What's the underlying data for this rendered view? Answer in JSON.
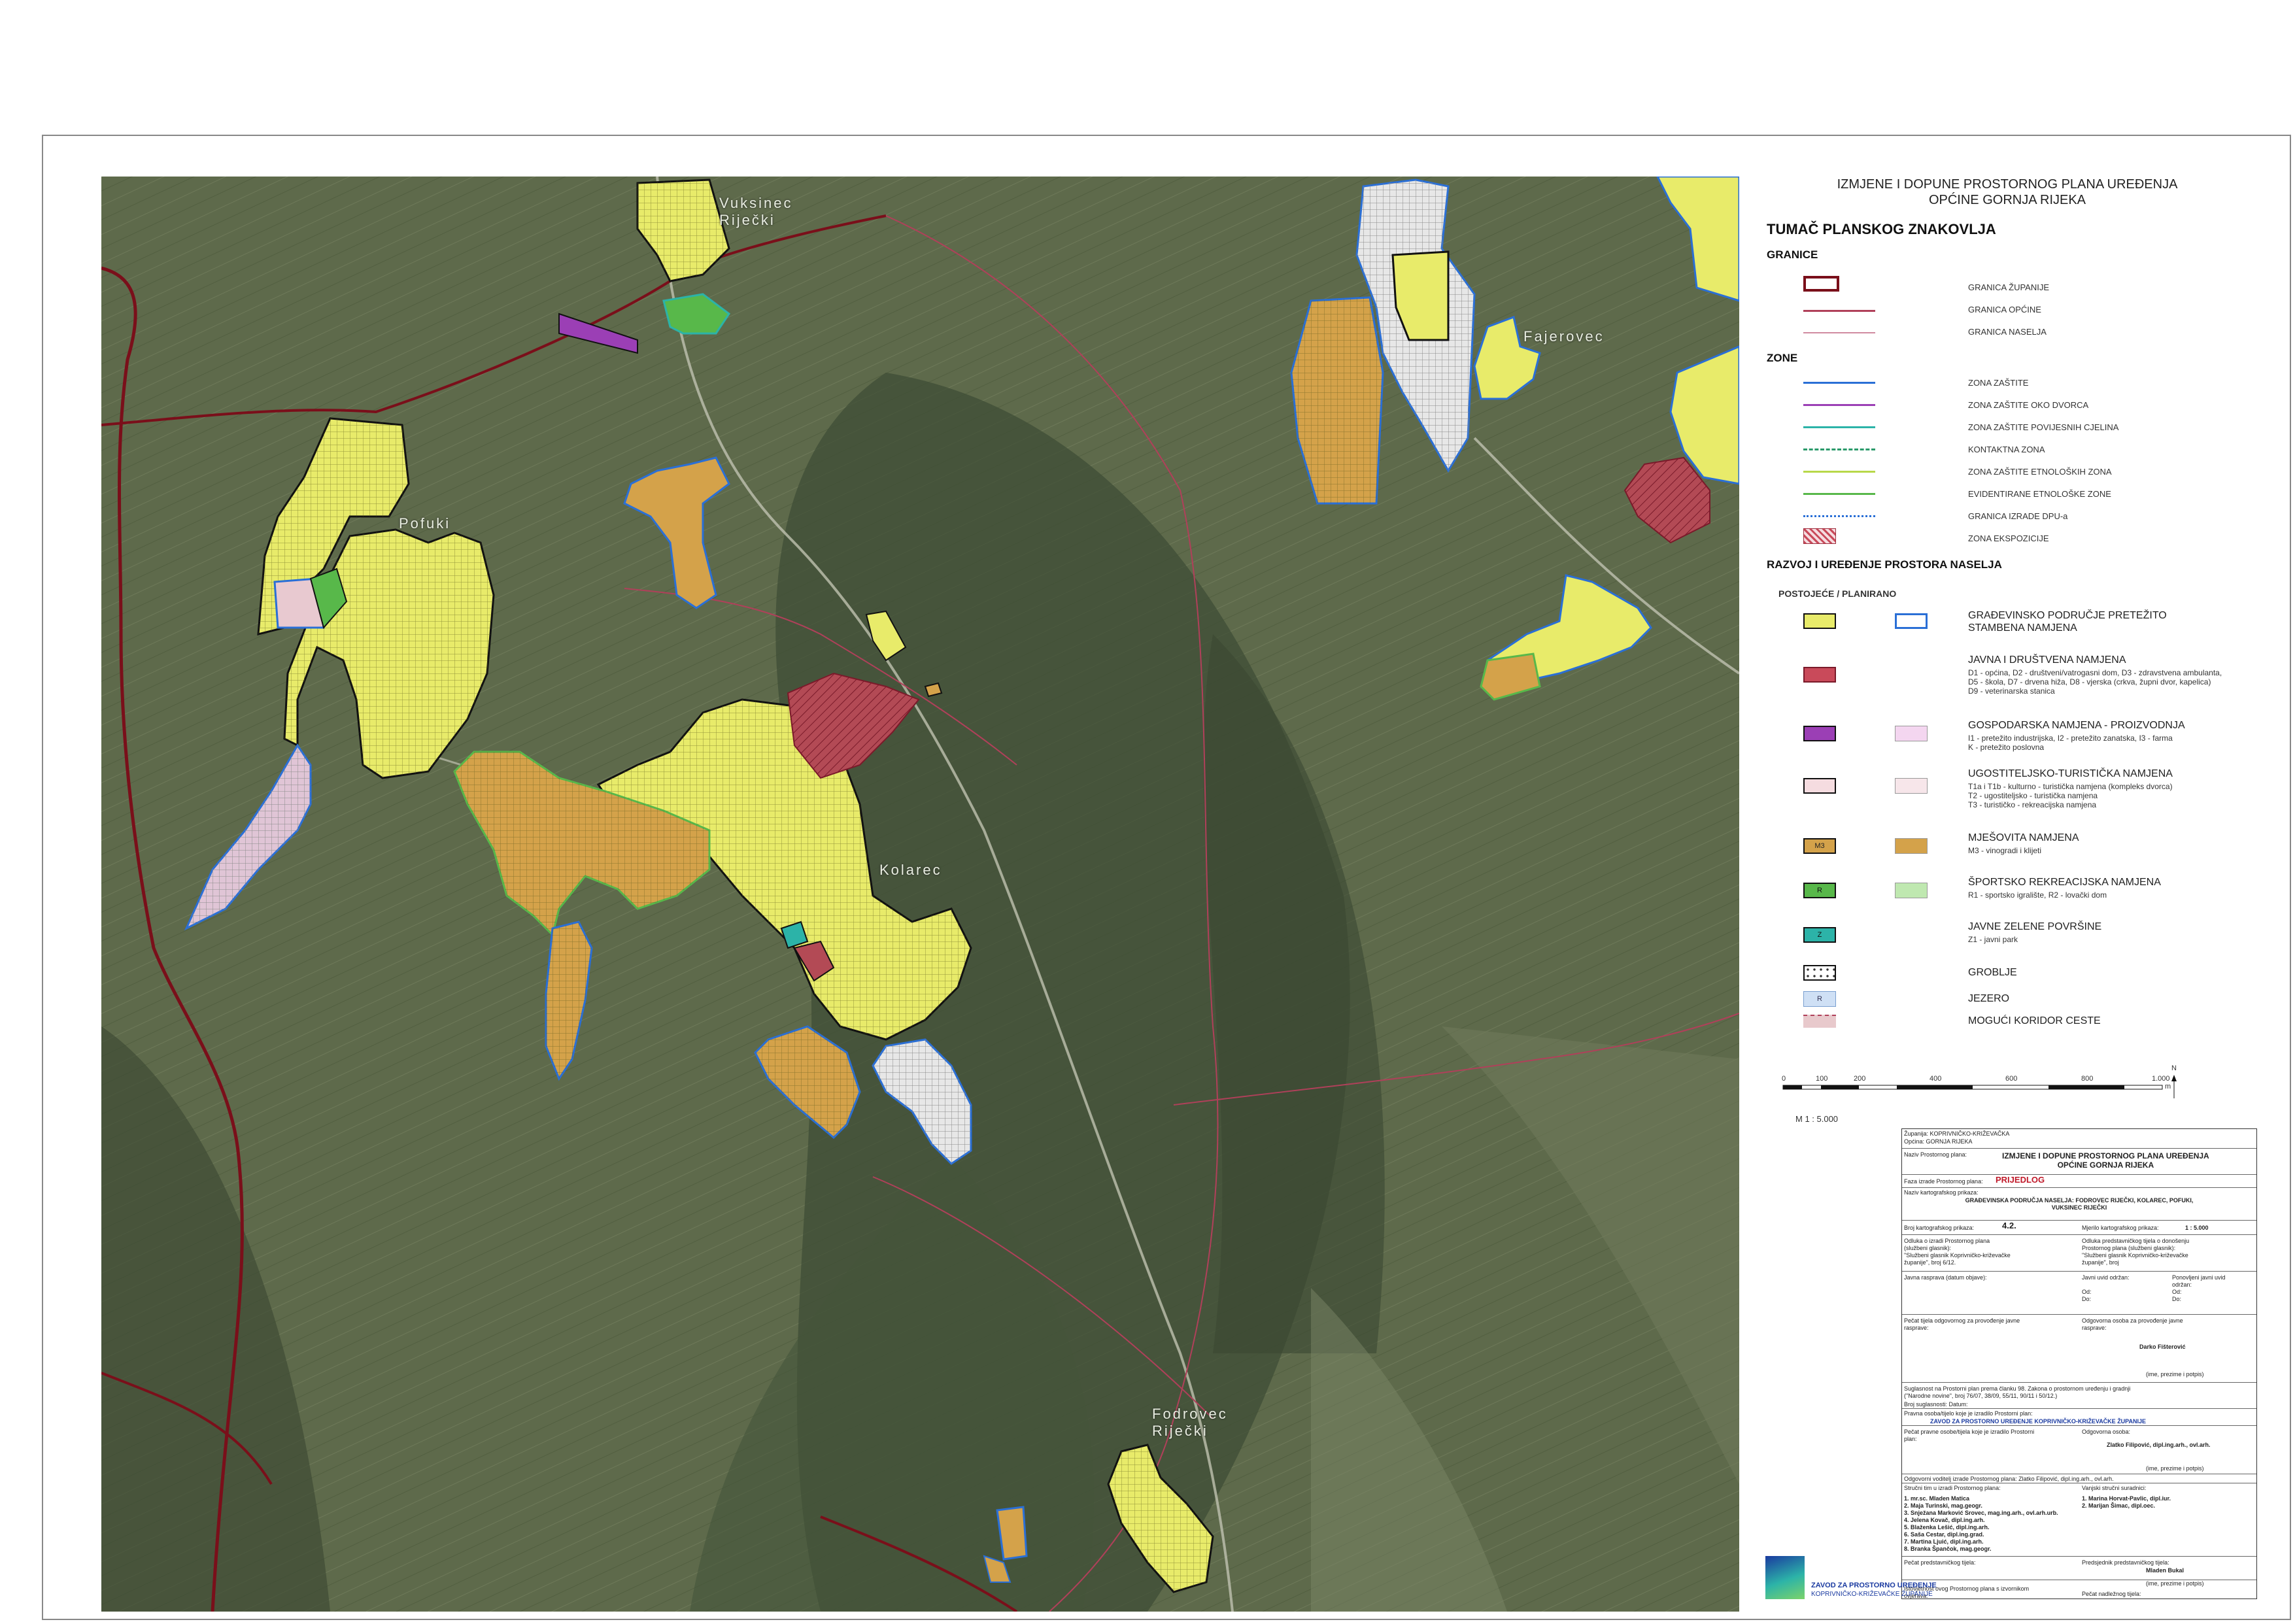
{
  "places": {
    "vuksinec": "Vuksinec\nRiječki",
    "fajerovec": "Fajerovec",
    "pofuki": "Pofuki",
    "kolarec": "Kolarec",
    "fodrovec": "Fodrovec\nRiječki"
  },
  "title": {
    "line1": "IZMJENE I DOPUNE PROSTORNOG PLANA UREĐENJA",
    "line2": "OPĆINE GORNJA RIJEKA"
  },
  "legend": {
    "heading": "TUMAČ PLANSKOG ZNAKOVLJA",
    "granice_heading": "GRANICE",
    "granice": [
      "GRANICA ŽUPANIJE",
      "GRANICA OPĆINE",
      "GRANICA NASELJA"
    ],
    "zone_heading": "ZONE",
    "zone": [
      "ZONA ZAŠTITE",
      "ZONA ZAŠTITE OKO DVORCA",
      "ZONA ZAŠTITE POVIJESNIH CJELINA",
      "KONTAKTNA ZONA",
      "ZONA ZAŠTITE ETNOLOŠKIH ZONA",
      "EVIDENTIRANE ETNOLOŠKE ZONE",
      "GRANICA IZRADE DPU-a",
      "ZONA EKSPOZICIJE"
    ],
    "razvoj_heading": "RAZVOJ I UREĐENJE PROSTORA NASELJA",
    "postojece_planirano": "POSTOJEĆE  /  PLANIRANO",
    "items": [
      {
        "title": "GRAĐEVINSKO PODRUČJE PRETEŽITO\nSTAMBENA NAMJENA",
        "sub": ""
      },
      {
        "title": "JAVNA I DRUŠTVENA NAMJENA",
        "sub": "D1 - općina, D2 - društveni/vatrogasni dom, D3 - zdravstvena ambulanta,\nD5 - škola, D7 - drvena hiža, D8 - vjerska (crkva, župni dvor, kapelica)\nD9 - veterinarska stanica"
      },
      {
        "title": "GOSPODARSKA  NAMJENA - PROIZVODNJA",
        "sub": "I1 - pretežito industrijska, I2 - pretežito zanatska, I3 - farma\nK - pretežito poslovna"
      },
      {
        "title": "UGOSTITELJSKO-TURISTIČKA NAMJENA",
        "sub": "T1a i T1b - kulturno - turistička namjena (kompleks dvorca)\nT2 - ugostiteljsko - turistička namjena\nT3 - turističko - rekreacijska namjena"
      },
      {
        "title": "MJEŠOVITA NAMJENA",
        "sub": "M3 - vinogradi i klijeti"
      },
      {
        "title": "ŠPORTSKO REKREACIJSKA NAMJENA",
        "sub": "R1 - sportsko igralište, R2 - lovački dom"
      },
      {
        "title": "JAVNE ZELENE POVRŠINE",
        "sub": "Z1 - javni park"
      },
      {
        "title": "GROBLJE",
        "sub": ""
      },
      {
        "title": "JEZERO",
        "sub": ""
      },
      {
        "title": "MOGUĆI KORIDOR CESTE",
        "sub": ""
      }
    ],
    "badges": {
      "m3": "M3",
      "r": "R",
      "z": "Z",
      "jezero": "R"
    }
  },
  "scale": {
    "ticks": [
      "0",
      "100",
      "200",
      "400",
      "600",
      "800",
      "1.000"
    ],
    "unit": "m",
    "ratio": "M 1 : 5.000",
    "north": "N"
  },
  "titleblock": {
    "zupanija": "Županija: KOPRIVNIČKO-KRIŽEVAČKA",
    "opcina": "Općina:   GORNJA RIJEKA",
    "naziv_label": "Naziv Prostornog plana:",
    "naziv": "IZMJENE I DOPUNE PROSTORNOG PLANA UREĐENJA\nOPĆINE GORNJA RIJEKA",
    "faza_label": "Faza izrade Prostornog plana:",
    "faza": "PRIJEDLOG",
    "naziv_prikaza_label": "Naziv kartografskog prikaza:",
    "naziv_prikaza": "GRAĐEVINSKA PODRUČJA NASELJA: FODROVEC RIJEČKI, KOLAREC, POFUKI,\nVUKSINEC RIJEČKI",
    "broj_label": "Broj kartografskog prikaza:",
    "broj": "4.2.",
    "mjerilo_label": "Mjerilo kartografskog prikaza:",
    "mjerilo": "1 : 5.000",
    "odluka_left": "Odluka o izradi Prostornog plana\n(službeni glasnik):\n\"Službeni glasnik Koprivničko-križevačke\nžupanije\", broj 6/12.",
    "odluka_right": "Odluka predstavničkog tijela o donošenju\nProstornog plana (službeni glasnik):\n\"Službeni glasnik Koprivničko-križevačke\nžupanije\", broj",
    "rasprava": "Javna rasprava (datum objave):",
    "uvid": "Javni uvid održan:\n\nOd:\nDo:",
    "ponovljeni": "Ponovljeni javni uvid\nodržan:\nOd:\nDo:",
    "pecat1": "Pečat tijela odgovornog za provođenje javne\nrasprave:",
    "odgovorna": "Odgovorna osoba za provođenje javne\nrasprave:",
    "odgovorna_ime": "Darko Fišterović",
    "ime1": "(ime, prezime i potpis)",
    "suglasnost": "Suglasnost na Prostorni plan prema članku 98. Zakona o prostornom uređenju i gradnji\n(\"Narodne novine\", broj 76/07, 38/09, 55/11, 90/11 i 50/12.)",
    "broj_suglasnosti": "Broj suglasnosti:    Datum:",
    "pravna": "Pravna osoba/tijelo koje je izradilo Prostorni plan:",
    "zavod": "ZAVOD ZA PROSTORNO UREĐENJE KOPRIVNIČKO-KRIŽEVAČKE ŽUPANIJE",
    "pecat2": "Pečat pravne osobe/tijela koje je izradilo Prostorni\nplan:",
    "odgovorna2": "Odgovorna osoba:",
    "odgovorna2_ime": "Zlatko Filipović, dipl.ing.arh., ovl.arh.",
    "ime2": "(ime, prezime i potpis)",
    "voditelj": "Odgovorni voditelj izrade Prostornog plana:  Zlatko Filipović, dipl.ing.arh., ovl.arh.",
    "strucni": "Stručni tim u izradi Prostornog plana:",
    "vanjski": "Vanjski stručni suradnici:",
    "tim": "1. mr.sc. Mladen Matica\n2. Maja Turinski, mag.geogr.\n3. Snježana Marković Srovec, mag.ing.arh., ovl.arh.urb.\n4. Jelena Kovač, dipl.ing.arh.\n5. Blaženka Lešić, dipl.ing.arh.\n6. Saša Cestar, dipl.ing.grad.\n7. Martina Ljuić, dipl.ing.arh.\n8. Branka Špančok, mag.geogr.",
    "vanjski_tim": "1. Marina Horvat-Pavlic, dipl.iur.\n2. Marijan Šimac, dipl.oec.",
    "pecat3": "Pečat predstavničkog tijela:",
    "predsjednik": "Predsjednik predstavničkog tijela:",
    "predsjednik_ime": "Mladen Bukal",
    "ime3": "(ime, prezime i potpis)",
    "istovjetnost": "Istovjetnost ovog Prostornog plana s izvornikom\novjerava:",
    "pecat4": "Pečat nadležnog tijela:",
    "ime4": "(ime, prezime i potpis)"
  },
  "logo": {
    "line1": "ZAVOD ZA PROSTORNO UREĐENJE",
    "line2": "KOPRIVNIČKO-KRIŽEVAČKE ŽUPANIJE"
  },
  "colors": {
    "stambena": "#e8eb6a",
    "javna": "#c94a5a",
    "gospodarska": "#9b3fb5",
    "mjesovita": "#d4a24a",
    "sport": "#58b84a",
    "zelena": "#2cb3a8",
    "planirano": "#2a6fd6",
    "zupanija": "#7a0f1a",
    "opcina": "#b0405a"
  }
}
